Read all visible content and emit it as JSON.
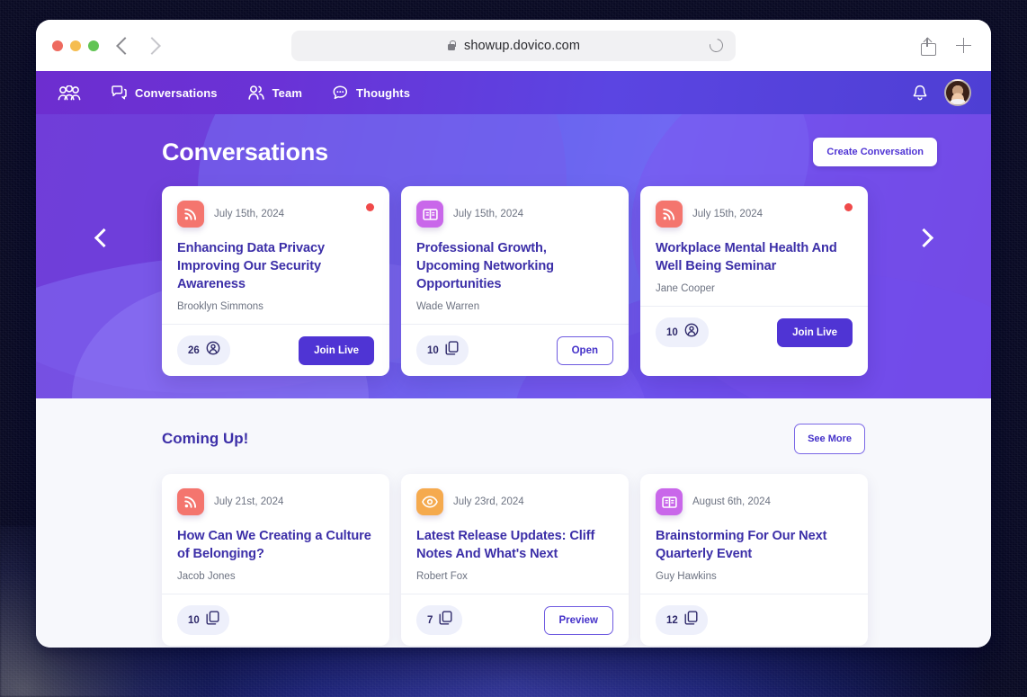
{
  "browser": {
    "url": "showup.dovico.com",
    "lock_icon": "lock-icon",
    "reload_icon": "reload-icon",
    "back_icon": "back-chevron-icon",
    "forward_icon": "forward-chevron-icon",
    "share_icon": "share-icon",
    "newtab_icon": "plus-icon"
  },
  "nav": {
    "logo_icon": "group-people-icon",
    "items": [
      {
        "label": "Conversations",
        "icon": "chat-bubbles-icon"
      },
      {
        "label": "Team",
        "icon": "two-people-icon"
      },
      {
        "label": "Thoughts",
        "icon": "thought-bubble-icon"
      }
    ],
    "bell_icon": "bell-icon",
    "avatar_icon": "user-avatar"
  },
  "hero": {
    "title": "Conversations",
    "create_label": "Create Conversation",
    "prev_icon": "chevron-left-icon",
    "next_icon": "chevron-right-icon"
  },
  "conversations": [
    {
      "icon": "rss-icon",
      "icon_color": "#f4756e",
      "date": "July 15th, 2024",
      "title": "Enhancing Data Privacy Improving Our Security Awareness",
      "author": "Brooklyn Simmons",
      "live": true,
      "count": "26",
      "count_icon": "person-circle-icon",
      "action": "Join Live",
      "action_style": "solid"
    },
    {
      "icon": "book-icon",
      "icon_color": "#c967ea",
      "date": "July 15th, 2024",
      "title": "Professional Growth, Upcoming Networking Opportunities",
      "author": "Wade Warren",
      "live": false,
      "count": "10",
      "count_icon": "copy-icon",
      "action": "Open",
      "action_style": "outline"
    },
    {
      "icon": "rss-icon",
      "icon_color": "#f4756e",
      "date": "July 15th, 2024",
      "title": "Workplace Mental Health And Well Being Seminar",
      "author": "Jane Cooper",
      "live": true,
      "count": "10",
      "count_icon": "person-circle-icon",
      "action": "Join Live",
      "action_style": "solid"
    }
  ],
  "coming_up": {
    "title": "Coming Up!",
    "see_more_label": "See More",
    "cards": [
      {
        "icon": "rss-icon",
        "icon_color": "#f4756e",
        "date": "July 21st, 2024",
        "title": "How Can We Creating a Culture of Belonging?",
        "author": "Jacob Jones",
        "live": false,
        "count": "10",
        "count_icon": "copy-icon",
        "action": "",
        "action_style": "none"
      },
      {
        "icon": "eye-icon",
        "icon_color": "#f5aa4e",
        "date": "July 23rd, 2024",
        "title": "Latest Release Updates: Cliff Notes And What's Next",
        "author": "Robert Fox",
        "live": false,
        "count": "7",
        "count_icon": "copy-icon",
        "action": "Preview",
        "action_style": "outline"
      },
      {
        "icon": "book-icon",
        "icon_color": "#c967ea",
        "date": "August 6th, 2024",
        "title": "Brainstorming For Our Next Quarterly Event",
        "author": "Guy Hawkins",
        "live": false,
        "count": "12",
        "count_icon": "copy-icon",
        "action": "",
        "action_style": "none"
      }
    ]
  },
  "colors": {
    "brand_purple": "#4f34d4",
    "title_purple": "#3c2fa8",
    "live_red": "#f04a4a",
    "page_bg": "#f7f8fc"
  }
}
